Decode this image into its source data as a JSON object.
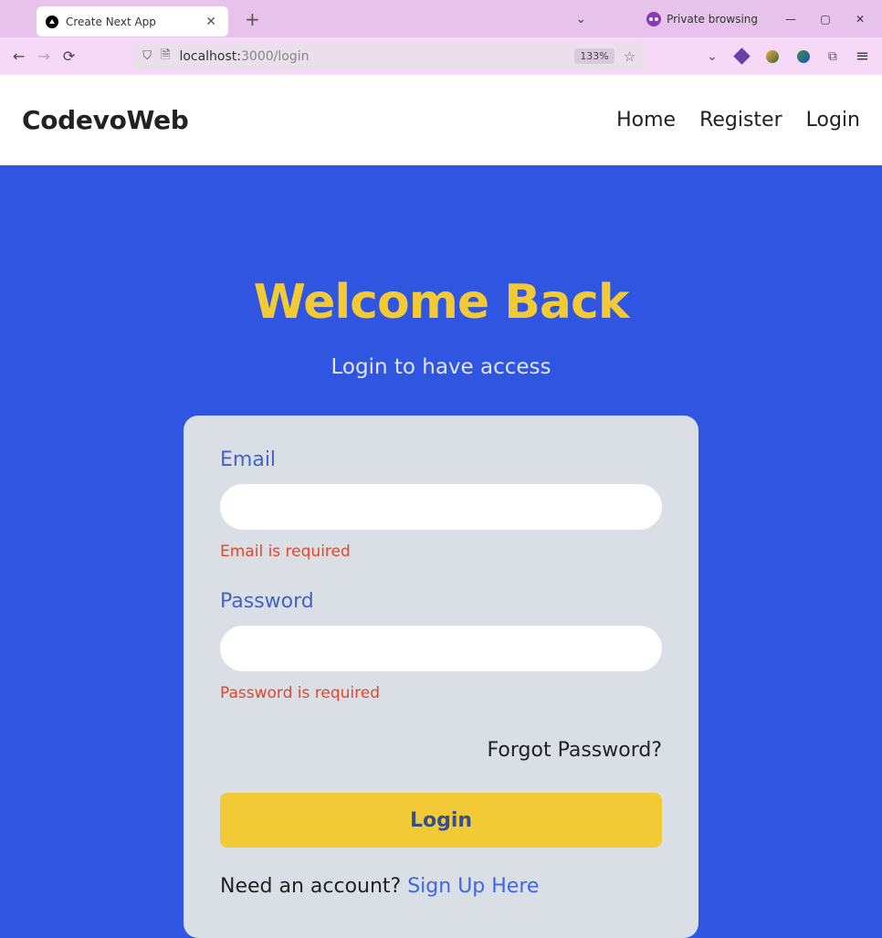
{
  "browser": {
    "tab_title": "Create Next App",
    "private_label": "Private browsing",
    "url_host": "localhost:",
    "url_path": "3000/login",
    "zoom": "133%"
  },
  "header": {
    "brand": "CodevoWeb",
    "nav": {
      "home": "Home",
      "register": "Register",
      "login": "Login"
    }
  },
  "page": {
    "title": "Welcome Back",
    "subtitle": "Login to have access",
    "form": {
      "email_label": "Email",
      "email_value": "",
      "email_error": "Email is required",
      "password_label": "Password",
      "password_value": "",
      "password_error": "Password is required",
      "forgot_label": "Forgot Password?",
      "submit_label": "Login",
      "signup_prompt": "Need an account? ",
      "signup_link": "Sign Up Here"
    }
  }
}
